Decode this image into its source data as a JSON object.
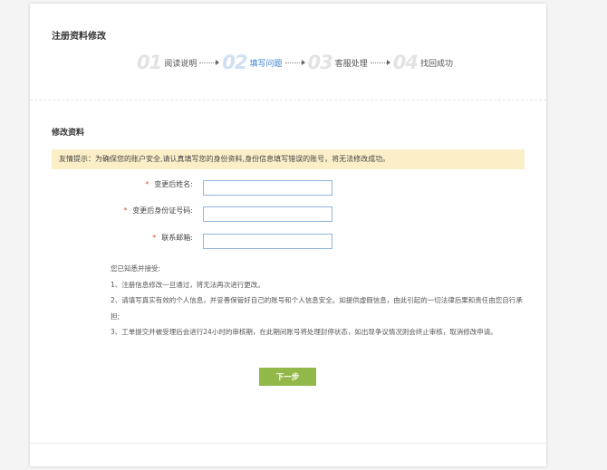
{
  "header": {
    "title": "注册资料修改"
  },
  "steps": [
    {
      "num": "01",
      "label": "阅读说明",
      "active": false
    },
    {
      "num": "02",
      "label": "填写问题",
      "active": true
    },
    {
      "num": "03",
      "label": "客服处理",
      "active": false
    },
    {
      "num": "04",
      "label": "找回成功",
      "active": false
    }
  ],
  "section": {
    "title": "修改资料"
  },
  "notice": {
    "text": "友情提示：为确保您的账户安全,请认真填写您的身份资料,身份信息填写错误的账号，将无法修改成功。"
  },
  "form": {
    "required_mark": "*",
    "fields": [
      {
        "label": "变更后姓名:",
        "value": "",
        "placeholder": ""
      },
      {
        "label": "变更后身份证号码:",
        "value": "",
        "placeholder": ""
      },
      {
        "label": "联系邮箱:",
        "value": "",
        "placeholder": ""
      }
    ]
  },
  "terms": {
    "intro": "您已知悉并接受:",
    "items": [
      "1、注册信息修改一旦通过，将无法再次进行更改。",
      "2、请填写真实有效的个人信息，并妥善保管好自己的账号和个人信息安全。如提供虚假信息，由此引起的一切法律后果和责任由您自行承担;",
      "3、工单提交并被受理后会进行24小时的审核期，在此期间账号将处理封停状态，如出现争议情况则会终止审核，取消修改申请。"
    ]
  },
  "actions": {
    "next_label": "下一步"
  },
  "colors": {
    "accent": "#3b7fd0",
    "button": "#93b84a",
    "notice_bg": "#fcefc8",
    "required": "#e0542a"
  }
}
